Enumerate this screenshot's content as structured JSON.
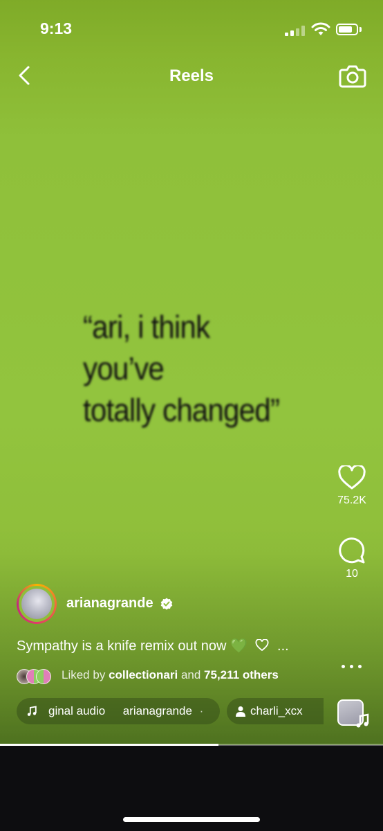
{
  "status_bar": {
    "time": "9:13",
    "battery_fraction": 0.8
  },
  "header": {
    "title": "Reels"
  },
  "video": {
    "quote_lines": [
      "“ari, i think",
      "you’ve",
      "totally changed”"
    ]
  },
  "actions": {
    "likes": "75.2K",
    "comments": "10"
  },
  "post": {
    "username": "arianagrande",
    "caption": "Sympathy is a knife remix out now 💚",
    "caption_more": "...",
    "liked_by_prefix": "Liked by",
    "liked_by_user": "collectionari",
    "liked_by_and": "and",
    "liked_by_others": "75,211 others"
  },
  "audio": {
    "title": "ginal audio",
    "artist": "arianagrande",
    "separator": "·"
  },
  "collaborator": {
    "name": "charli_xcx"
  },
  "playback": {
    "progress_fraction": 0.57
  },
  "colors": {
    "video_bg": "#92c43e",
    "quote_text": "#111111"
  },
  "icons": [
    "back-chevron-icon",
    "camera-icon",
    "heart-icon",
    "comment-icon",
    "share-icon",
    "more-icon",
    "music-note-icon",
    "verified-badge-icon",
    "person-icon"
  ]
}
